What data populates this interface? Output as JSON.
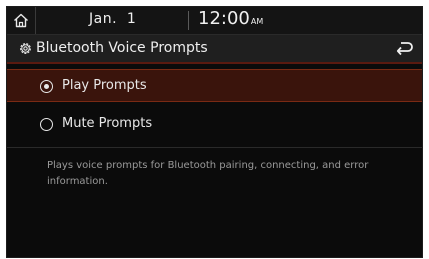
{
  "status": {
    "date": "Jan.  1",
    "time": "12:00",
    "ampm": "AM"
  },
  "header": {
    "title": "Bluetooth Voice Prompts"
  },
  "options": [
    {
      "label": "Play Prompts",
      "selected": true
    },
    {
      "label": "Mute Prompts",
      "selected": false
    }
  ],
  "description": "Plays voice prompts for Bluetooth pairing, connecting, and error information.",
  "icons": {
    "home": "home-icon",
    "settings": "gear-icon",
    "back": "back-arrow-icon"
  }
}
